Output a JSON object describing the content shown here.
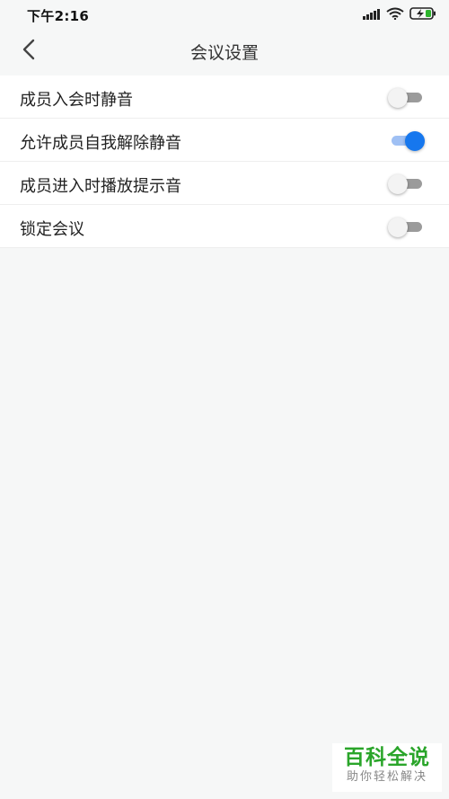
{
  "status_bar": {
    "time": "下午2:16",
    "icons": [
      "signal-icon",
      "wifi-icon",
      "battery-charging-icon"
    ]
  },
  "nav": {
    "title": "会议设置",
    "back_icon": "chevron-left-icon"
  },
  "settings": [
    {
      "label": "成员入会时静音",
      "enabled": false
    },
    {
      "label": "允许成员自我解除静音",
      "enabled": true
    },
    {
      "label": "成员进入时播放提示音",
      "enabled": false
    },
    {
      "label": "锁定会议",
      "enabled": false
    }
  ],
  "colors": {
    "background": "#f6f7f7",
    "accent": "#1677ee",
    "accent_track": "#9fc0f4",
    "toggle_off_track": "#9b9b9b"
  },
  "watermark": {
    "main": "百科全说",
    "sub": "助你轻松解决"
  }
}
